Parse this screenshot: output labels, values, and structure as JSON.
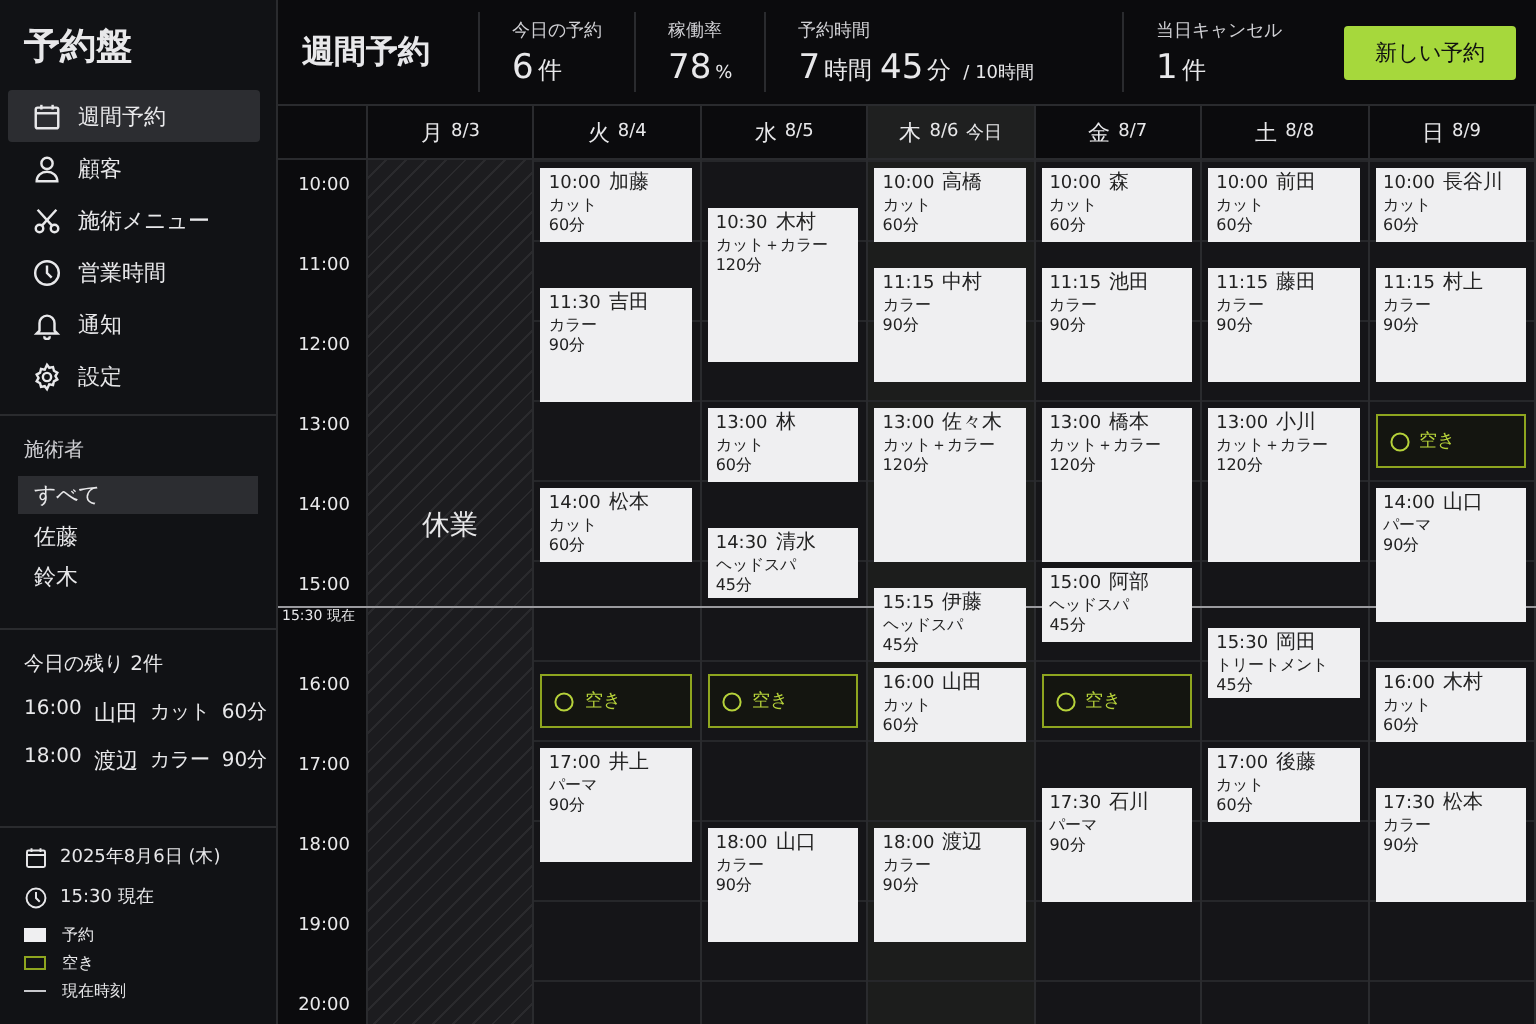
{
  "app": {
    "title": "予約盤"
  },
  "nav": [
    {
      "label": "週間予約",
      "selected": true
    },
    {
      "label": "顧客",
      "selected": false
    },
    {
      "label": "施術メニュー",
      "selected": false
    },
    {
      "label": "営業時間",
      "selected": false
    },
    {
      "label": "通知",
      "selected": false
    },
    {
      "label": "設定",
      "selected": false
    }
  ],
  "staff": {
    "title": "施術者",
    "items": [
      {
        "label": "すべて",
        "selected": true
      },
      {
        "label": "佐藤",
        "selected": false
      },
      {
        "label": "鈴木",
        "selected": false
      }
    ]
  },
  "remaining": {
    "title": "今日の残り 2件",
    "rows": [
      {
        "time": "16:00",
        "name": "山田",
        "service": "カット",
        "duration": "60分"
      },
      {
        "time": "18:00",
        "name": "渡辺",
        "service": "カラー",
        "duration": "90分"
      }
    ]
  },
  "status": {
    "date": "2025年8月6日 (木)",
    "now": "15:30 現在"
  },
  "legend": [
    {
      "kind": "booking",
      "label": "予約"
    },
    {
      "kind": "open",
      "label": "空き"
    },
    {
      "kind": "now",
      "label": "現在時刻"
    }
  ],
  "header": {
    "title": "週間予約",
    "stats": [
      {
        "label": "今日の予約",
        "value": [
          {
            "kind": "num",
            "text": "6"
          },
          {
            "kind": "unit",
            "text": "件"
          }
        ]
      },
      {
        "label": "稼働率",
        "value": [
          {
            "kind": "num",
            "text": "78"
          },
          {
            "kind": "small",
            "text": "%"
          }
        ]
      },
      {
        "label": "予約時間",
        "value": [
          {
            "kind": "num",
            "text": "7"
          },
          {
            "kind": "unit",
            "text": "時間"
          },
          {
            "kind": "num",
            "text": "45"
          },
          {
            "kind": "unit",
            "text": "分"
          },
          {
            "kind": "small",
            "text": "/ 10時間"
          }
        ]
      },
      {
        "label": "当日キャンセル",
        "value": [
          {
            "kind": "num",
            "text": "1"
          },
          {
            "kind": "unit",
            "text": "件"
          }
        ]
      }
    ],
    "button": "新しい予約"
  },
  "grid": {
    "hours": [
      "10:00",
      "11:00",
      "12:00",
      "13:00",
      "14:00",
      "15:00",
      "16:00",
      "17:00",
      "18:00",
      "19:00",
      "20:00"
    ],
    "now_label": "15:30 現在",
    "days": [
      {
        "weekday": "月",
        "date": "8/3",
        "today": false,
        "closed": true,
        "closed_label": "休業"
      },
      {
        "weekday": "火",
        "date": "8/4",
        "today": false,
        "closed": false,
        "events": [
          {
            "kind": "booking",
            "start": "10:00",
            "name": "加藤",
            "service": "カット",
            "duration": "60分"
          },
          {
            "kind": "booking",
            "start": "11:30",
            "name": "吉田",
            "service": "カラー",
            "duration": "90分"
          },
          {
            "kind": "booking",
            "start": "14:00",
            "name": "松本",
            "service": "カット",
            "duration": "60分"
          },
          {
            "kind": "open",
            "label": "空き"
          },
          {
            "kind": "booking",
            "start": "17:00",
            "name": "井上",
            "service": "パーマ",
            "duration": "90分"
          }
        ]
      },
      {
        "weekday": "水",
        "date": "8/5",
        "today": false,
        "closed": false,
        "events": [
          {
            "kind": "booking",
            "start": "10:30",
            "name": "木村",
            "service": "カット＋カラー",
            "duration": "120分"
          },
          {
            "kind": "booking",
            "start": "13:00",
            "name": "林",
            "service": "カット",
            "duration": "60分"
          },
          {
            "kind": "booking",
            "start": "14:30",
            "name": "清水",
            "service": "ヘッドスパ",
            "duration": "45分"
          },
          {
            "kind": "open",
            "label": "空き"
          },
          {
            "kind": "booking",
            "start": "18:00",
            "name": "山口",
            "service": "カラー",
            "duration": "90分"
          }
        ]
      },
      {
        "weekday": "木",
        "date": "8/6",
        "today": true,
        "today_label": "今日",
        "closed": false,
        "events": [
          {
            "kind": "booking",
            "start": "10:00",
            "name": "高橋",
            "service": "カット",
            "duration": "60分"
          },
          {
            "kind": "booking",
            "start": "11:15",
            "name": "中村",
            "service": "カラー",
            "duration": "90分"
          },
          {
            "kind": "booking",
            "start": "13:00",
            "name": "佐々木",
            "service": "カット＋カラー",
            "duration": "120分"
          },
          {
            "kind": "booking",
            "start": "15:15",
            "name": "伊藤",
            "service": "ヘッドスパ",
            "duration": "45分"
          },
          {
            "kind": "booking",
            "start": "16:00",
            "name": "山田",
            "service": "カット",
            "duration": "60分"
          },
          {
            "kind": "booking",
            "start": "18:00",
            "name": "渡辺",
            "service": "カラー",
            "duration": "90分"
          }
        ]
      },
      {
        "weekday": "金",
        "date": "8/7",
        "today": false,
        "closed": false,
        "events": [
          {
            "kind": "booking",
            "start": "10:00",
            "name": "森",
            "service": "カット",
            "duration": "60分"
          },
          {
            "kind": "booking",
            "start": "11:15",
            "name": "池田",
            "service": "カラー",
            "duration": "90分"
          },
          {
            "kind": "booking",
            "start": "13:00",
            "name": "橋本",
            "service": "カット＋カラー",
            "duration": "120分"
          },
          {
            "kind": "booking",
            "start": "15:00",
            "name": "阿部",
            "service": "ヘッドスパ",
            "duration": "45分"
          },
          {
            "kind": "open",
            "label": "空き"
          },
          {
            "kind": "booking",
            "start": "17:30",
            "name": "石川",
            "service": "パーマ",
            "duration": "90分"
          }
        ]
      },
      {
        "weekday": "土",
        "date": "8/8",
        "today": false,
        "closed": false,
        "events": [
          {
            "kind": "booking",
            "start": "10:00",
            "name": "前田",
            "service": "カット",
            "duration": "60分"
          },
          {
            "kind": "booking",
            "start": "11:15",
            "name": "藤田",
            "service": "カラー",
            "duration": "90分"
          },
          {
            "kind": "booking",
            "start": "13:00",
            "name": "小川",
            "service": "カット＋カラー",
            "duration": "120分"
          },
          {
            "kind": "booking",
            "start": "15:30",
            "name": "岡田",
            "service": "トリートメント",
            "duration": "45分"
          },
          {
            "kind": "booking",
            "start": "17:00",
            "name": "後藤",
            "service": "カット",
            "duration": "60分"
          }
        ]
      },
      {
        "weekday": "日",
        "date": "8/9",
        "today": false,
        "closed": false,
        "events": [
          {
            "kind": "booking",
            "start": "10:00",
            "name": "長谷川",
            "service": "カット",
            "duration": "60分"
          },
          {
            "kind": "booking",
            "start": "11:15",
            "name": "村上",
            "service": "カラー",
            "duration": "90分"
          },
          {
            "kind": "open",
            "label": "空き"
          },
          {
            "kind": "booking",
            "start": "14:00",
            "name": "山口",
            "service": "パーマ",
            "duration": "90分"
          },
          {
            "kind": "booking",
            "start": "16:00",
            "name": "木村",
            "service": "カット",
            "duration": "60分"
          },
          {
            "kind": "booking",
            "start": "17:30",
            "name": "松本",
            "service": "カラー",
            "duration": "90分"
          }
        ]
      }
    ]
  }
}
